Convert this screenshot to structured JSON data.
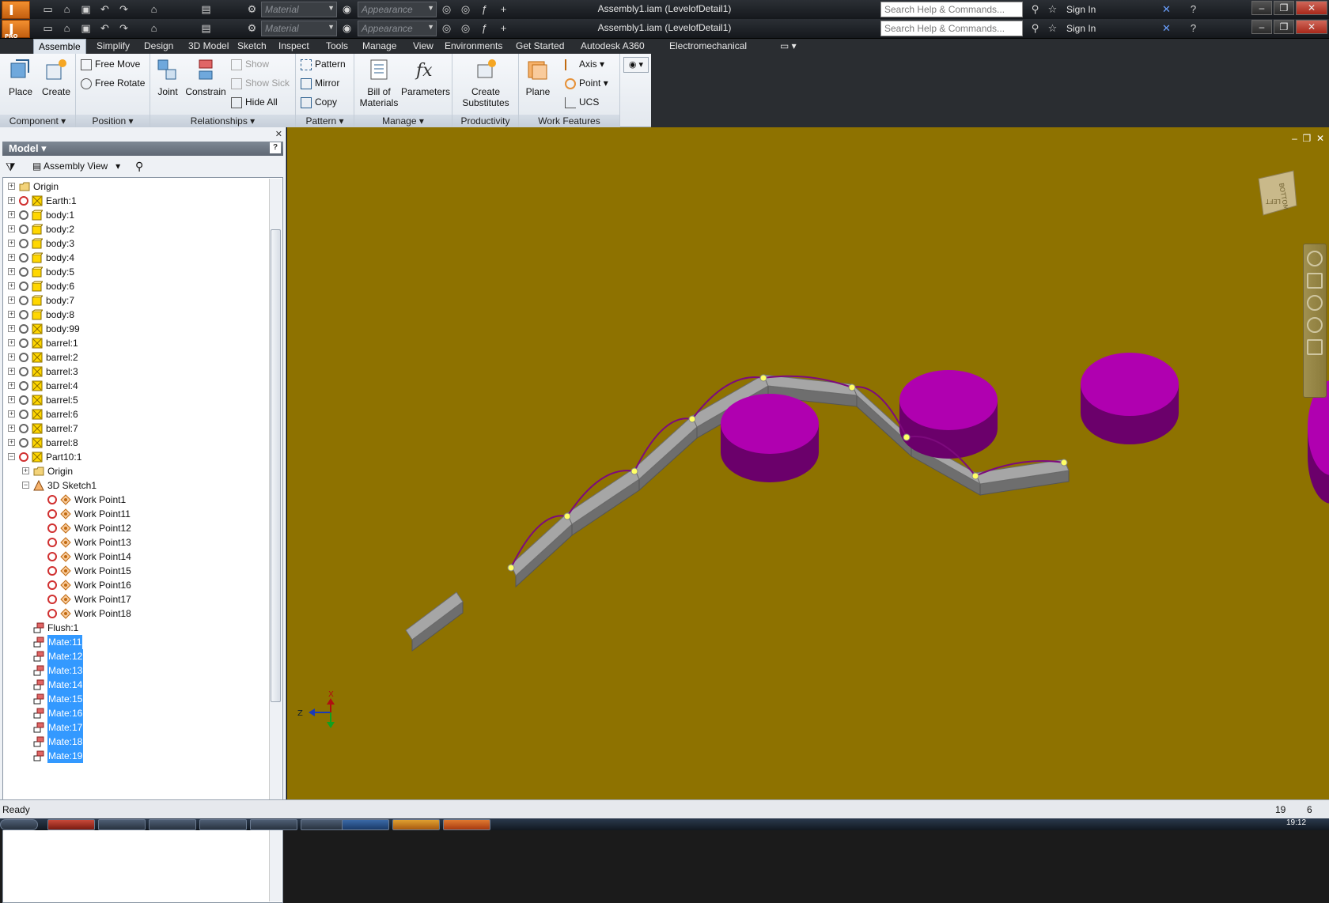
{
  "app": {
    "window_title": "Assembly1.iam (LevelofDetail1)",
    "logo_letter": "I",
    "logo_edition": "PRO",
    "qat_material": "Material",
    "qat_appearance": "Appearance",
    "search_placeholder": "Search Help & Commands...",
    "sign_in": "Sign In"
  },
  "ribbon": {
    "tabs": [
      "Assemble",
      "Simplify",
      "Design",
      "3D Model",
      "Sketch",
      "Inspect",
      "Tools",
      "Manage",
      "View",
      "Environments",
      "Get Started",
      "Autodesk A360",
      "Electromechanical"
    ],
    "active_tab": "Assemble",
    "groups": {
      "component": {
        "label": "Component",
        "place": "Place",
        "create": "Create"
      },
      "position": {
        "label": "Position",
        "free_move": "Free Move",
        "free_rotate": "Free Rotate"
      },
      "relationships": {
        "label": "Relationships",
        "joint": "Joint",
        "constrain": "Constrain",
        "show": "Show",
        "show_sick": "Show Sick",
        "hide_all": "Hide All"
      },
      "pattern": {
        "label": "Pattern",
        "pattern": "Pattern",
        "mirror": "Mirror",
        "copy": "Copy"
      },
      "manage": {
        "label": "Manage",
        "bom_line1": "Bill of",
        "bom_line2": "Materials",
        "parameters": "Parameters"
      },
      "productivity": {
        "label": "Productivity",
        "cs_line1": "Create",
        "cs_line2": "Substitutes"
      },
      "work_features": {
        "label": "Work Features",
        "plane": "Plane",
        "axis": "Axis",
        "point": "Point",
        "ucs": "UCS"
      }
    }
  },
  "browser": {
    "title": "Model",
    "view": "Assembly View",
    "items": [
      {
        "label": "Origin",
        "type": "folder",
        "indent": 0,
        "sel": false
      },
      {
        "label": "Earth:1",
        "type": "grounded",
        "indent": 0,
        "sel": false
      },
      {
        "label": "body:1",
        "type": "part",
        "indent": 0,
        "sel": false
      },
      {
        "label": "body:2",
        "type": "part",
        "indent": 0,
        "sel": false
      },
      {
        "label": "body:3",
        "type": "part",
        "indent": 0,
        "sel": false
      },
      {
        "label": "body:4",
        "type": "part",
        "indent": 0,
        "sel": false
      },
      {
        "label": "body:5",
        "type": "part",
        "indent": 0,
        "sel": false
      },
      {
        "label": "body:6",
        "type": "part",
        "indent": 0,
        "sel": false
      },
      {
        "label": "body:7",
        "type": "part",
        "indent": 0,
        "sel": false
      },
      {
        "label": "body:8",
        "type": "part",
        "indent": 0,
        "sel": false
      },
      {
        "label": "body:99",
        "type": "part2",
        "indent": 0,
        "sel": false
      },
      {
        "label": "barrel:1",
        "type": "part2",
        "indent": 0,
        "sel": false
      },
      {
        "label": "barrel:2",
        "type": "part2",
        "indent": 0,
        "sel": false
      },
      {
        "label": "barrel:3",
        "type": "part2",
        "indent": 0,
        "sel": false
      },
      {
        "label": "barrel:4",
        "type": "part2",
        "indent": 0,
        "sel": false
      },
      {
        "label": "barrel:5",
        "type": "part2",
        "indent": 0,
        "sel": false
      },
      {
        "label": "barrel:6",
        "type": "part2",
        "indent": 0,
        "sel": false
      },
      {
        "label": "barrel:7",
        "type": "part2",
        "indent": 0,
        "sel": false
      },
      {
        "label": "barrel:8",
        "type": "part2",
        "indent": 0,
        "sel": false
      },
      {
        "label": "Part10:1",
        "type": "grounded",
        "indent": 0,
        "sel": false
      },
      {
        "label": "Origin",
        "type": "folder",
        "indent": 1,
        "sel": false
      },
      {
        "label": "3D Sketch1",
        "type": "sketch",
        "indent": 1,
        "sel": false
      },
      {
        "label": "Work Point1",
        "type": "workpoint",
        "indent": 2,
        "sel": false
      },
      {
        "label": "Work Point11",
        "type": "workpoint",
        "indent": 2,
        "sel": false
      },
      {
        "label": "Work Point12",
        "type": "workpoint",
        "indent": 2,
        "sel": false
      },
      {
        "label": "Work Point13",
        "type": "workpoint",
        "indent": 2,
        "sel": false
      },
      {
        "label": "Work Point14",
        "type": "workpoint",
        "indent": 2,
        "sel": false
      },
      {
        "label": "Work Point15",
        "type": "workpoint",
        "indent": 2,
        "sel": false
      },
      {
        "label": "Work Point16",
        "type": "workpoint",
        "indent": 2,
        "sel": false
      },
      {
        "label": "Work Point17",
        "type": "workpoint",
        "indent": 2,
        "sel": false
      },
      {
        "label": "Work Point18",
        "type": "workpoint",
        "indent": 2,
        "sel": false
      },
      {
        "label": "Flush:1",
        "type": "constraint",
        "indent": 1,
        "sel": false
      },
      {
        "label": "Mate:11",
        "type": "constraint",
        "indent": 1,
        "sel": true
      },
      {
        "label": "Mate:12",
        "type": "constraint",
        "indent": 1,
        "sel": true
      },
      {
        "label": "Mate:13",
        "type": "constraint",
        "indent": 1,
        "sel": true
      },
      {
        "label": "Mate:14",
        "type": "constraint",
        "indent": 1,
        "sel": true
      },
      {
        "label": "Mate:15",
        "type": "constraint",
        "indent": 1,
        "sel": true
      },
      {
        "label": "Mate:16",
        "type": "constraint",
        "indent": 1,
        "sel": true
      },
      {
        "label": "Mate:17",
        "type": "constraint",
        "indent": 1,
        "sel": true
      },
      {
        "label": "Mate:18",
        "type": "constraint",
        "indent": 1,
        "sel": true
      },
      {
        "label": "Mate:19",
        "type": "constraint",
        "indent": 1,
        "sel": true
      }
    ]
  },
  "viewport": {
    "background": "#8e7200",
    "viewcube_top": "BOTTOM",
    "viewcube_side": "LEFT",
    "triad_x": "X",
    "triad_z": "Z",
    "cylinder_color": "#b000b0",
    "body_color": "#8c8c8c",
    "workpoint_color": "#ffff66"
  },
  "status": {
    "text": "Ready",
    "count1": "19",
    "count2": "6",
    "clock": "19:12"
  }
}
